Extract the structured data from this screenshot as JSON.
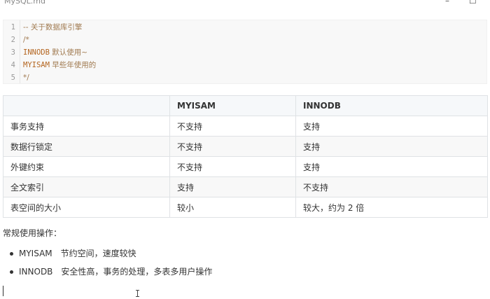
{
  "window": {
    "title": "MySQL.md",
    "minimize_glyph": "–",
    "maximize_glyph": "☐"
  },
  "code_block": {
    "lines": [
      {
        "number": "1",
        "text": "-- 关于数据库引擎"
      },
      {
        "number": "2",
        "text": "/*"
      },
      {
        "number": "3",
        "keyword": "INNODB",
        "text": " 默认使用~"
      },
      {
        "number": "4",
        "keyword": "MYISAM",
        "text": " 早些年使用的"
      },
      {
        "number": "5",
        "text": "*/"
      }
    ]
  },
  "table": {
    "headers": [
      "",
      "MYISAM",
      "INNODB"
    ],
    "rows": [
      [
        "事务支持",
        "不支持",
        "支持"
      ],
      [
        "数据行锁定",
        "不支持",
        "支持"
      ],
      [
        "外键约束",
        "不支持",
        "支持"
      ],
      [
        "全文索引",
        "支持",
        "不支持"
      ],
      [
        "表空间的大小",
        "较小",
        "较大，约为 2 倍"
      ]
    ]
  },
  "paragraph": "常规使用操作：",
  "bullets": [
    {
      "name": "MYISAM",
      "text": "节约空间，速度较快"
    },
    {
      "name": "INNODB",
      "text": "安全性高，事务的处理，多表多用户操作"
    }
  ],
  "colors": {
    "comment": "#a07a50",
    "keyword": "#b4651f",
    "table_border": "#dfe2e5",
    "code_bg": "#f8f8f8"
  },
  "icons": [
    "text-cursor-icon",
    "i-beam-pointer-icon"
  ]
}
